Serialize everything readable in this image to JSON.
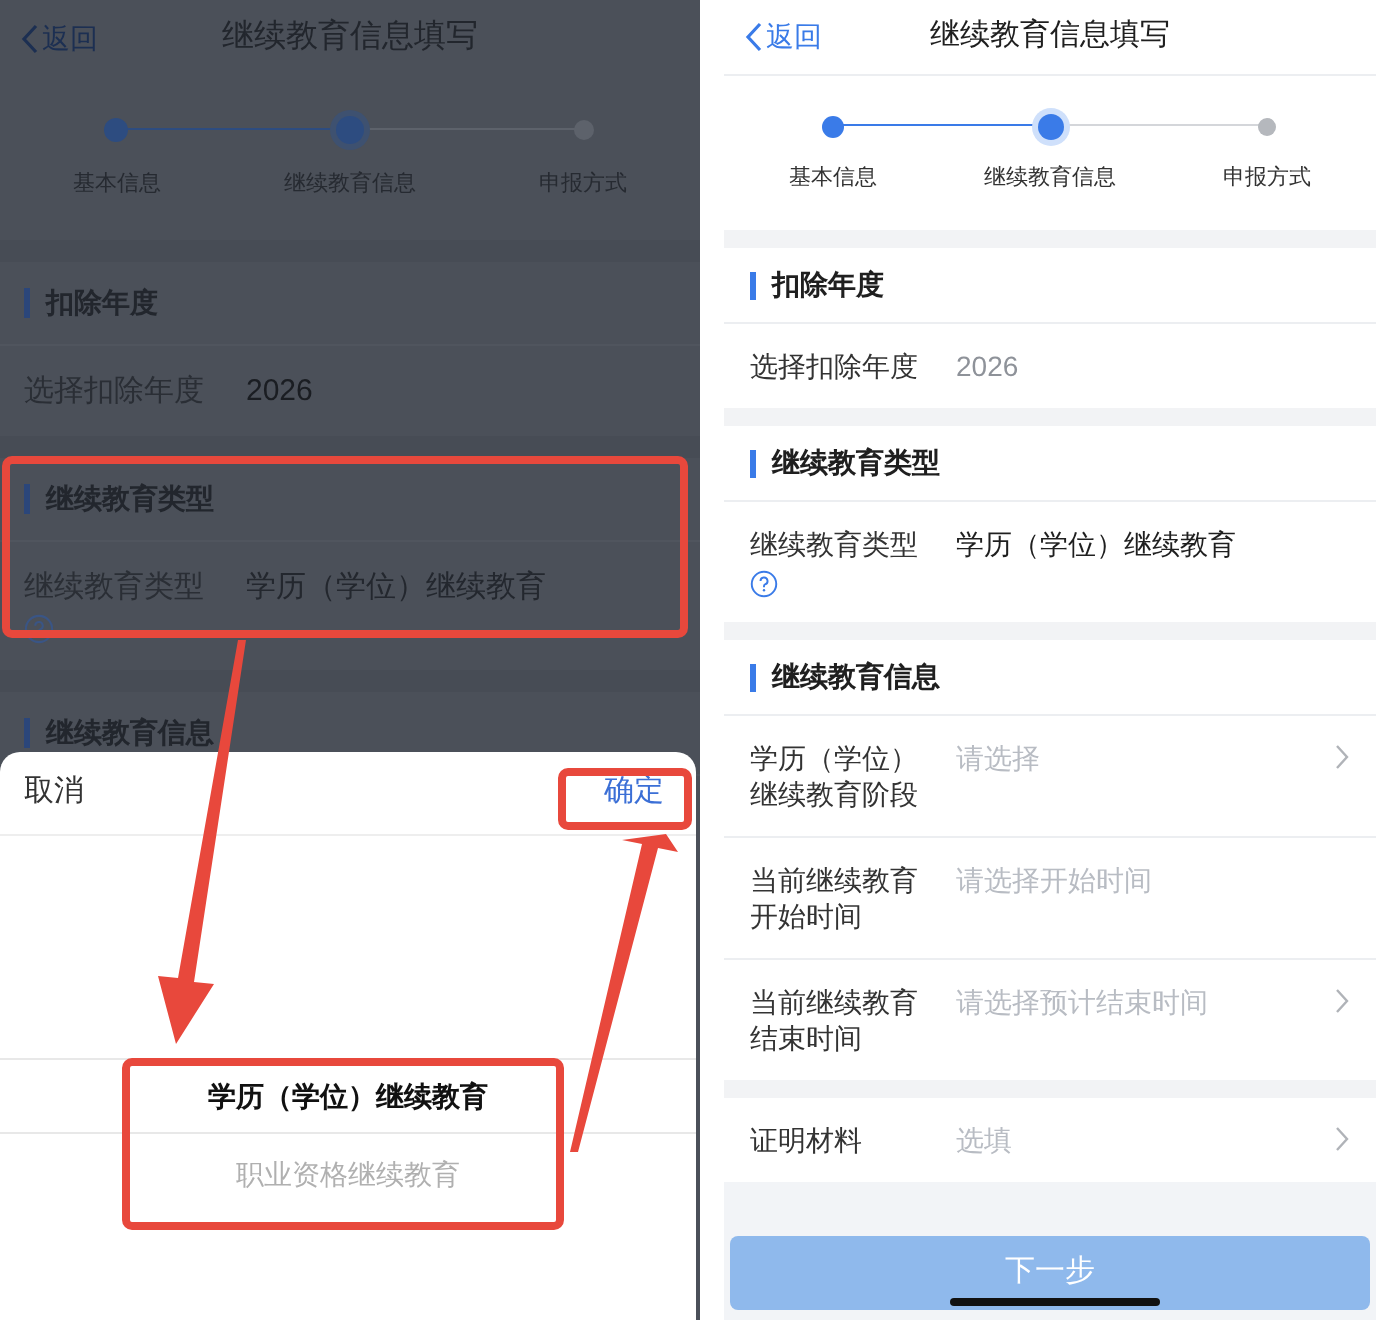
{
  "screens": [
    {
      "dimmed": true,
      "nav": {
        "back": "返回",
        "title": "继续教育信息填写"
      },
      "steps": [
        {
          "label": "基本信息",
          "completed": true,
          "selected": false
        },
        {
          "label": "继续教育信息",
          "completed": true,
          "selected": true
        },
        {
          "label": "申报方式",
          "completed": false,
          "selected": false
        }
      ],
      "sections": [
        {
          "title": "扣除年度",
          "rows": [
            {
              "label": "选择扣除年度",
              "value": "2026",
              "kind": "readonly"
            }
          ]
        },
        {
          "title": "继续教育类型",
          "rows": [
            {
              "label": "继续教育类型",
              "value": "学历（学位）继续教育",
              "kind": "choice",
              "help": true
            }
          ]
        },
        {
          "title": "继续教育信息"
        }
      ],
      "sheet": {
        "cancel": "取消",
        "confirm": "确定",
        "options": [
          {
            "label": "学历（学位）继续教育",
            "selected": true
          },
          {
            "label": "职业资格继续教育",
            "selected": false
          }
        ]
      }
    },
    {
      "dimmed": false,
      "nav": {
        "back": "返回",
        "title": "继续教育信息填写"
      },
      "steps": [
        {
          "label": "基本信息",
          "completed": true,
          "selected": false
        },
        {
          "label": "继续教育信息",
          "completed": true,
          "selected": true
        },
        {
          "label": "申报方式",
          "completed": false,
          "selected": false
        }
      ],
      "sections": [
        {
          "title": "扣除年度",
          "rows": [
            {
              "label": "选择扣除年度",
              "value": "2026",
              "kind": "readonly"
            }
          ]
        },
        {
          "title": "继续教育类型",
          "rows": [
            {
              "label": "继续教育类型",
              "value": "学历（学位）继续教育",
              "kind": "choice",
              "help": true
            }
          ]
        },
        {
          "title": "继续教育信息",
          "rows": [
            {
              "label": "学历（学位）继续教育阶段",
              "placeholder": "请选择",
              "kind": "picker",
              "chevron": true
            },
            {
              "label": "当前继续教育开始时间",
              "placeholder": "请选择开始时间",
              "kind": "picker"
            },
            {
              "label": "当前继续教育结束时间",
              "placeholder": "请选择预计结束时间",
              "kind": "picker",
              "chevron": true
            }
          ]
        },
        {
          "rows": [
            {
              "label": "证明材料",
              "placeholder": "选填",
              "kind": "picker",
              "chevron": true
            }
          ]
        }
      ],
      "next_button": {
        "label": "下一步",
        "disabled": true
      }
    }
  ]
}
